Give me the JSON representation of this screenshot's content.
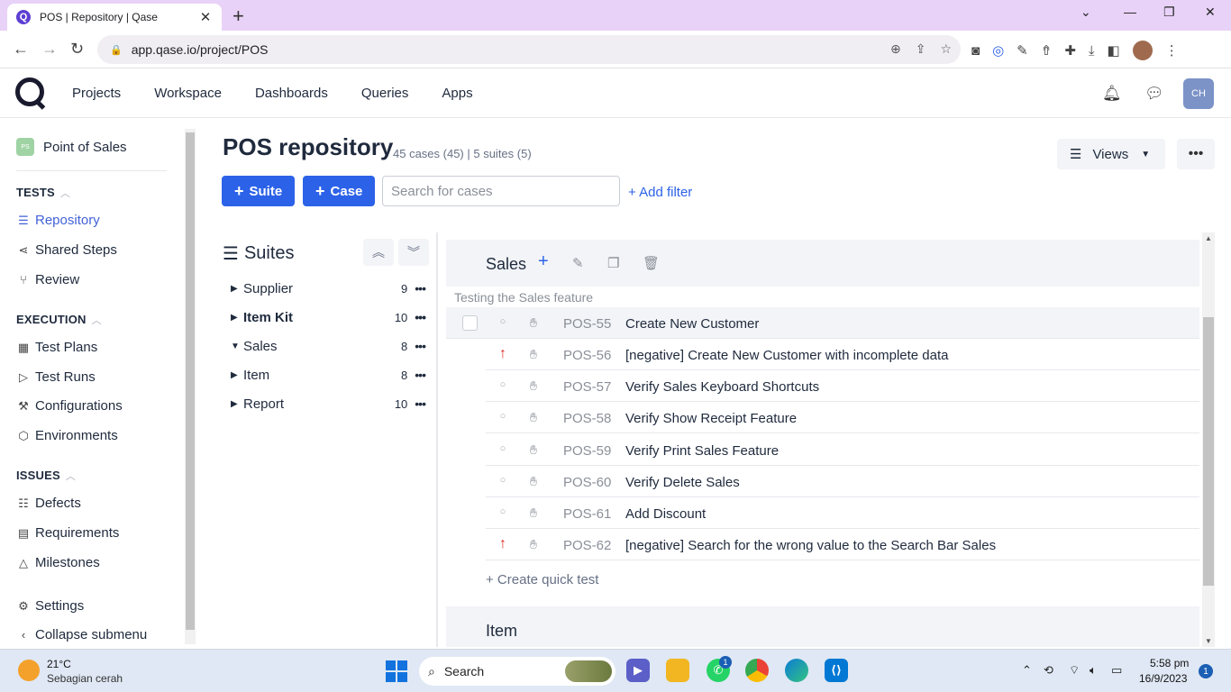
{
  "browser": {
    "tab_title": "POS | Repository | Qase",
    "tab_favicon": "Q",
    "url": "app.qase.io/project/POS"
  },
  "header": {
    "nav": [
      "Projects",
      "Workspace",
      "Dashboards",
      "Queries",
      "Apps"
    ],
    "user_initials": "CH"
  },
  "sidebar": {
    "project_name": "Point of Sales",
    "project_badge": "PS",
    "sections": {
      "tests": "TESTS",
      "execution": "EXECUTION",
      "issues": "ISSUES"
    },
    "tests_items": [
      "Repository",
      "Shared Steps",
      "Review"
    ],
    "execution_items": [
      "Test Plans",
      "Test Runs",
      "Configurations",
      "Environments"
    ],
    "issues_items": [
      "Defects",
      "Requirements",
      "Milestones"
    ],
    "settings": "Settings",
    "collapse": "Collapse submenu"
  },
  "main": {
    "title": "POS repository",
    "meta": "45 cases (45) | 5 suites (5)",
    "views_label": "Views",
    "suite_button": "Suite",
    "case_button": "Case",
    "search_placeholder": "Search for cases",
    "add_filter": "+ Add filter"
  },
  "suites": {
    "heading": "Suites",
    "items": [
      {
        "name": "Supplier",
        "count": "9",
        "expanded": false
      },
      {
        "name": "Item Kit",
        "count": "10",
        "expanded": false
      },
      {
        "name": "Sales",
        "count": "8",
        "expanded": true
      },
      {
        "name": "Item",
        "count": "8",
        "expanded": false
      },
      {
        "name": "Report",
        "count": "10",
        "expanded": false
      }
    ]
  },
  "suite_detail": {
    "title": "Sales",
    "description": "Testing the Sales feature",
    "cases": [
      {
        "id": "POS-55",
        "title": "Create New Customer",
        "priority": "none"
      },
      {
        "id": "POS-56",
        "title": "[negative] Create New Customer with incomplete data",
        "priority": "high"
      },
      {
        "id": "POS-57",
        "title": "Verify Sales Keyboard Shortcuts",
        "priority": "none"
      },
      {
        "id": "POS-58",
        "title": "Verify Show Receipt Feature",
        "priority": "none"
      },
      {
        "id": "POS-59",
        "title": "Verify Print Sales Feature",
        "priority": "none"
      },
      {
        "id": "POS-60",
        "title": "Verify Delete Sales",
        "priority": "none"
      },
      {
        "id": "POS-61",
        "title": "Add Discount",
        "priority": "none"
      },
      {
        "id": "POS-62",
        "title": "[negative] Search for the wrong value to the Search Bar Sales",
        "priority": "high"
      }
    ],
    "quick_test": "+ Create quick test",
    "next_suite": "Item"
  },
  "taskbar": {
    "temperature": "21°C",
    "weather": "Sebagian cerah",
    "search": "Search",
    "whatsapp_badge": "1",
    "time": "5:58 pm",
    "date": "16/9/2023",
    "notifications": "1"
  },
  "colors": {
    "accent": "#2c62e8",
    "active_nav": "#4362d8",
    "priority_high": "#d92d20",
    "tab_strip": "#e8d2f7"
  }
}
